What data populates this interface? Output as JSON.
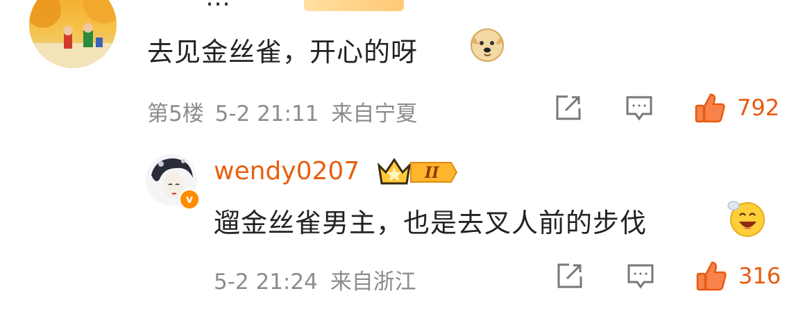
{
  "top_comment": {
    "partial_text": "…",
    "text": "去见金丝雀，开心的呀",
    "emoji": "doge-emoji",
    "floor": "第5楼",
    "time": "5-2 21:11",
    "location": "来自宁夏",
    "likes": "792"
  },
  "reply": {
    "username": "wendy0207",
    "badge_level": "II",
    "text": "遛金丝雀男主，也是去叉人前的步伐",
    "emoji": "laughing-emoji",
    "time": "5-2 21:24",
    "location": "来自浙江",
    "likes": "316",
    "verified_mark": "v"
  },
  "colors": {
    "accent_orange": "#e8600f",
    "meta_gray": "#8c8c8c",
    "text_dark": "#222222"
  }
}
